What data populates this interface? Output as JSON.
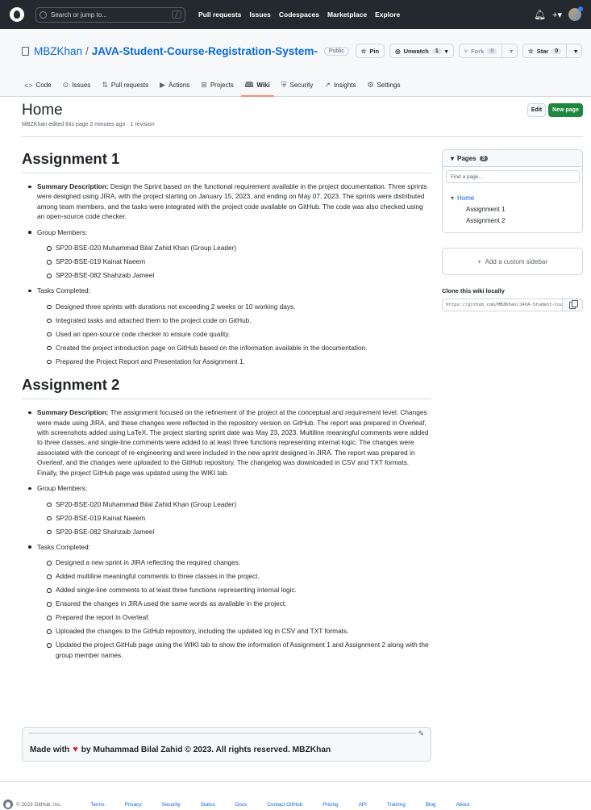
{
  "topbar": {
    "search_placeholder": "Search or jump to...",
    "search_key": "/",
    "nav": [
      "Pull requests",
      "Issues",
      "Codespaces",
      "Marketplace",
      "Explore"
    ]
  },
  "repo": {
    "owner": "MBZKhan",
    "name": "JAVA-Student-Course-Registration-System-",
    "visibility": "Public",
    "pin_label": "Pin",
    "unwatch_label": "Unwatch",
    "unwatch_count": "1",
    "fork_label": "Fork",
    "fork_count": "0",
    "star_label": "Star",
    "star_count": "0",
    "tabs": [
      "Code",
      "Issues",
      "Pull requests",
      "Actions",
      "Projects",
      "Wiki",
      "Security",
      "Insights",
      "Settings"
    ]
  },
  "wiki": {
    "title": "Home",
    "meta": "MBZKhan edited this page 2 minutes ago · 1 revision",
    "edit_label": "Edit",
    "new_page_label": "New page"
  },
  "content": {
    "a1": {
      "heading": "Assignment 1",
      "summary_label": "Summary Description:",
      "summary_text": " Design the Sprint based on the functional requirement available in the project documentation. Three sprints were designed using JIRA, with the project starting on January 15, 2023, and ending on May 07, 2023. The sprints were distributed among team members, and the tasks were integrated with the project code available on GitHub. The code was also checked using an open-source code checker.",
      "members_label": "Group Members:",
      "members": [
        "SP20-BSE-020 Muhammad Bilal Zahid Khan (Group Leader)",
        "SP20-BSE-019 Kainat Naeem",
        "SP20-BSE-082 Shahzaib Jameel"
      ],
      "tasks_label": "Tasks Completed:",
      "tasks": [
        "Designed three sprints with durations not exceeding 2 weeks or 10 working days.",
        "Integrated tasks and attached them to the project code on GitHub.",
        "Used an open-source code checker to ensure code quality.",
        "Created the project introduction page on GitHub based on the information available in the documentation.",
        "Prepared the Project Report and Presentation for Assignment 1."
      ]
    },
    "a2": {
      "heading": "Assignment 2",
      "summary_label": "Summary Description:",
      "summary_text": " The assignment focused on the refinement of the project at the conceptual and requirement level. Changes were made using JIRA, and these changes were reflected in the repository version on GitHub. The report was prepared in Overleaf, with screenshots added using LaTeX. The project starting sprint date was May 23, 2023. Multiline meaningful comments were added to three classes, and single-line comments were added to at least three functions representing internal logic. The changes were associated with the concept of re-engineering and were included in the new sprint designed in JIRA. The report was prepared in Overleaf, and the changes were uploaded to the GitHub repository. The changelog was downloaded in CSV and TXT formats. Finally, the project GitHub page was updated using the WIKI tab.",
      "members_label": "Group Members:",
      "members": [
        "SP20-BSE-020 Muhammad Bilal Zahid Khan (Group Leader)",
        "SP20-BSE-019 Kainat Naeem",
        "SP20-BSE-082 Shahzaib Jameel"
      ],
      "tasks_label": "Tasks Completed:",
      "tasks": [
        "Designed a new sprint in JIRA reflecting the required changes.",
        "Added multiline meaningful comments to three classes in the project.",
        "Added single-line comments to at least three functions representing internal logic.",
        "Ensured the changes in JIRA used the same words as available in the project.",
        "Prepared the report in Overleaf.",
        "Uploaded the changes to the GitHub repository, including the updated log in CSV and TXT formats.",
        "Updated the project GitHub page using the WIKI tab to show the information of Assignment 1 and Assignment 2 along with the group member names."
      ]
    }
  },
  "wiki_footer": {
    "made_with": "Made with",
    "by_text": "by Muhammad Bilal Zahid © 2023. All rights reserved. MBZKhan"
  },
  "sidebar": {
    "pages_label": "Pages",
    "pages_count": "3",
    "find_placeholder": "Find a page...",
    "home": "Home",
    "subpages": [
      "Assignment 1",
      "Assignment 2"
    ],
    "add_sidebar": "Add a custom sidebar",
    "clone_label": "Clone this wiki locally",
    "clone_url": "https://github.com/MBZKhan/JAVA-Student-Course-Registration-System-.wiki.git"
  },
  "footer": {
    "copyright": "© 2023 GitHub, Inc.",
    "links": [
      "Terms",
      "Privacy",
      "Security",
      "Status",
      "Docs",
      "Contact GitHub",
      "Pricing",
      "API",
      "Training",
      "Blog",
      "About"
    ]
  },
  "colors": {
    "accent": "#0969da",
    "primary_button": "#1f883d",
    "header_bg": "#24292f",
    "active_tab": "#fd8c73"
  }
}
